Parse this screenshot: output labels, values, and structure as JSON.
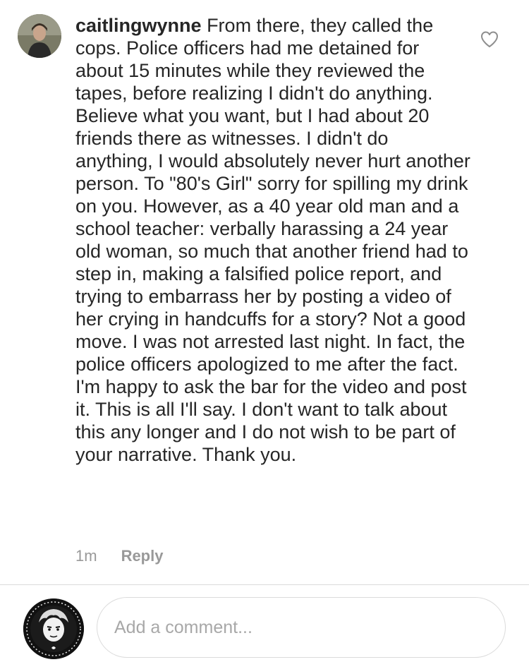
{
  "comment": {
    "username": "caitlingwynne",
    "text": "From there, they called the cops. Police officers had me detained for about 15 minutes while they reviewed the tapes, before realizing I didn't do anything. Believe what you want, but I had about 20 friends there as witnesses. I didn't do anything, I would absolutely never hurt another person. To \"80's Girl\" sorry for spilling my drink on you. However, as a 40 year old man and a school teacher: verbally harassing a 24 year old woman, so much that another friend had to step in, making a falsified police report, and trying to embarrass her by posting a video of her crying in handcuffs for a story? Not a good move. I was not arrested last night. In fact, the police officers apologized to me after the fact. I'm happy to ask the bar for the video and post it. This is all I'll say. I don't want to talk about this any longer and I do not wish to be part of your narrative. Thank you.",
    "time": "1m",
    "reply_label": "Reply",
    "like_icon": "heart-outline-icon"
  },
  "composer": {
    "placeholder": "Add a comment..."
  }
}
